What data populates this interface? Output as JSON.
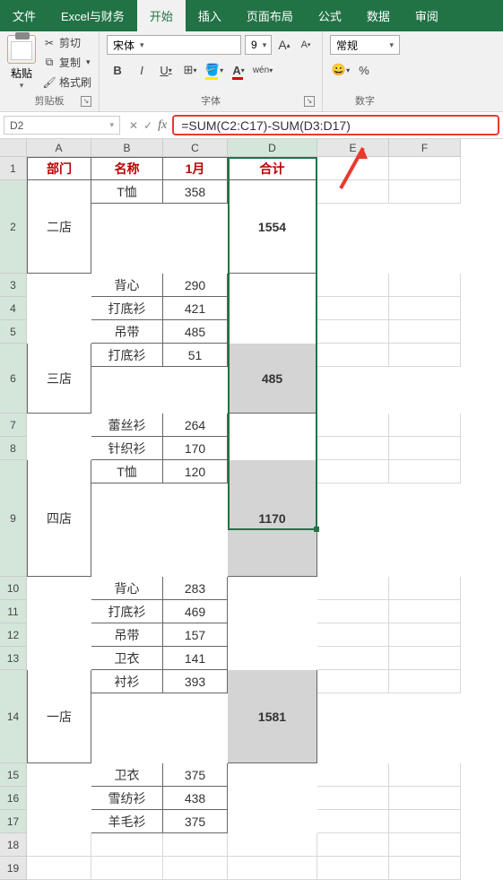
{
  "tabs": {
    "file": "文件",
    "excel_finance": "Excel与财务",
    "start": "开始",
    "insert": "插入",
    "layout": "页面布局",
    "formula": "公式",
    "data": "数据",
    "review": "审阅"
  },
  "clipboard": {
    "paste": "粘贴",
    "cut": "剪切",
    "copy": "复制",
    "format_painter": "格式刷",
    "group_label": "剪贴板"
  },
  "font": {
    "name": "宋体",
    "size": "9",
    "group_label": "字体",
    "bold": "B",
    "italic": "I",
    "underline": "U",
    "pinyin": "wén"
  },
  "number": {
    "format": "常规",
    "percent": "%",
    "group_label": "数字"
  },
  "cellref": "D2",
  "formula": "=SUM(C2:C17)-SUM(D3:D17)",
  "columns": [
    "A",
    "B",
    "C",
    "D",
    "E",
    "F"
  ],
  "headers": {
    "dept": "部门",
    "name": "名称",
    "jan": "1月",
    "total": "合计"
  },
  "chart_data": {
    "type": "table",
    "columns": [
      "部门",
      "名称",
      "1月",
      "合计"
    ],
    "groups": [
      {
        "dept": "二店",
        "total": 1554,
        "rows": [
          {
            "name": "T恤",
            "jan": 358
          },
          {
            "name": "背心",
            "jan": 290
          },
          {
            "name": "打底衫",
            "jan": 421
          },
          {
            "name": "吊带",
            "jan": 485
          }
        ]
      },
      {
        "dept": "三店",
        "total": 485,
        "rows": [
          {
            "name": "打底衫",
            "jan": 51
          },
          {
            "name": "蕾丝衫",
            "jan": 264
          },
          {
            "name": "针织衫",
            "jan": 170
          }
        ]
      },
      {
        "dept": "四店",
        "total": 1170,
        "rows": [
          {
            "name": "T恤",
            "jan": 120
          },
          {
            "name": "背心",
            "jan": 283
          },
          {
            "name": "打底衫",
            "jan": 469
          },
          {
            "name": "吊带",
            "jan": 157
          },
          {
            "name": "卫衣",
            "jan": 141
          }
        ]
      },
      {
        "dept": "一店",
        "total": 1581,
        "rows": [
          {
            "name": "衬衫",
            "jan": 393
          },
          {
            "name": "卫衣",
            "jan": 375
          },
          {
            "name": "雪纺衫",
            "jan": 438
          },
          {
            "name": "羊毛衫",
            "jan": 375
          }
        ]
      }
    ]
  }
}
